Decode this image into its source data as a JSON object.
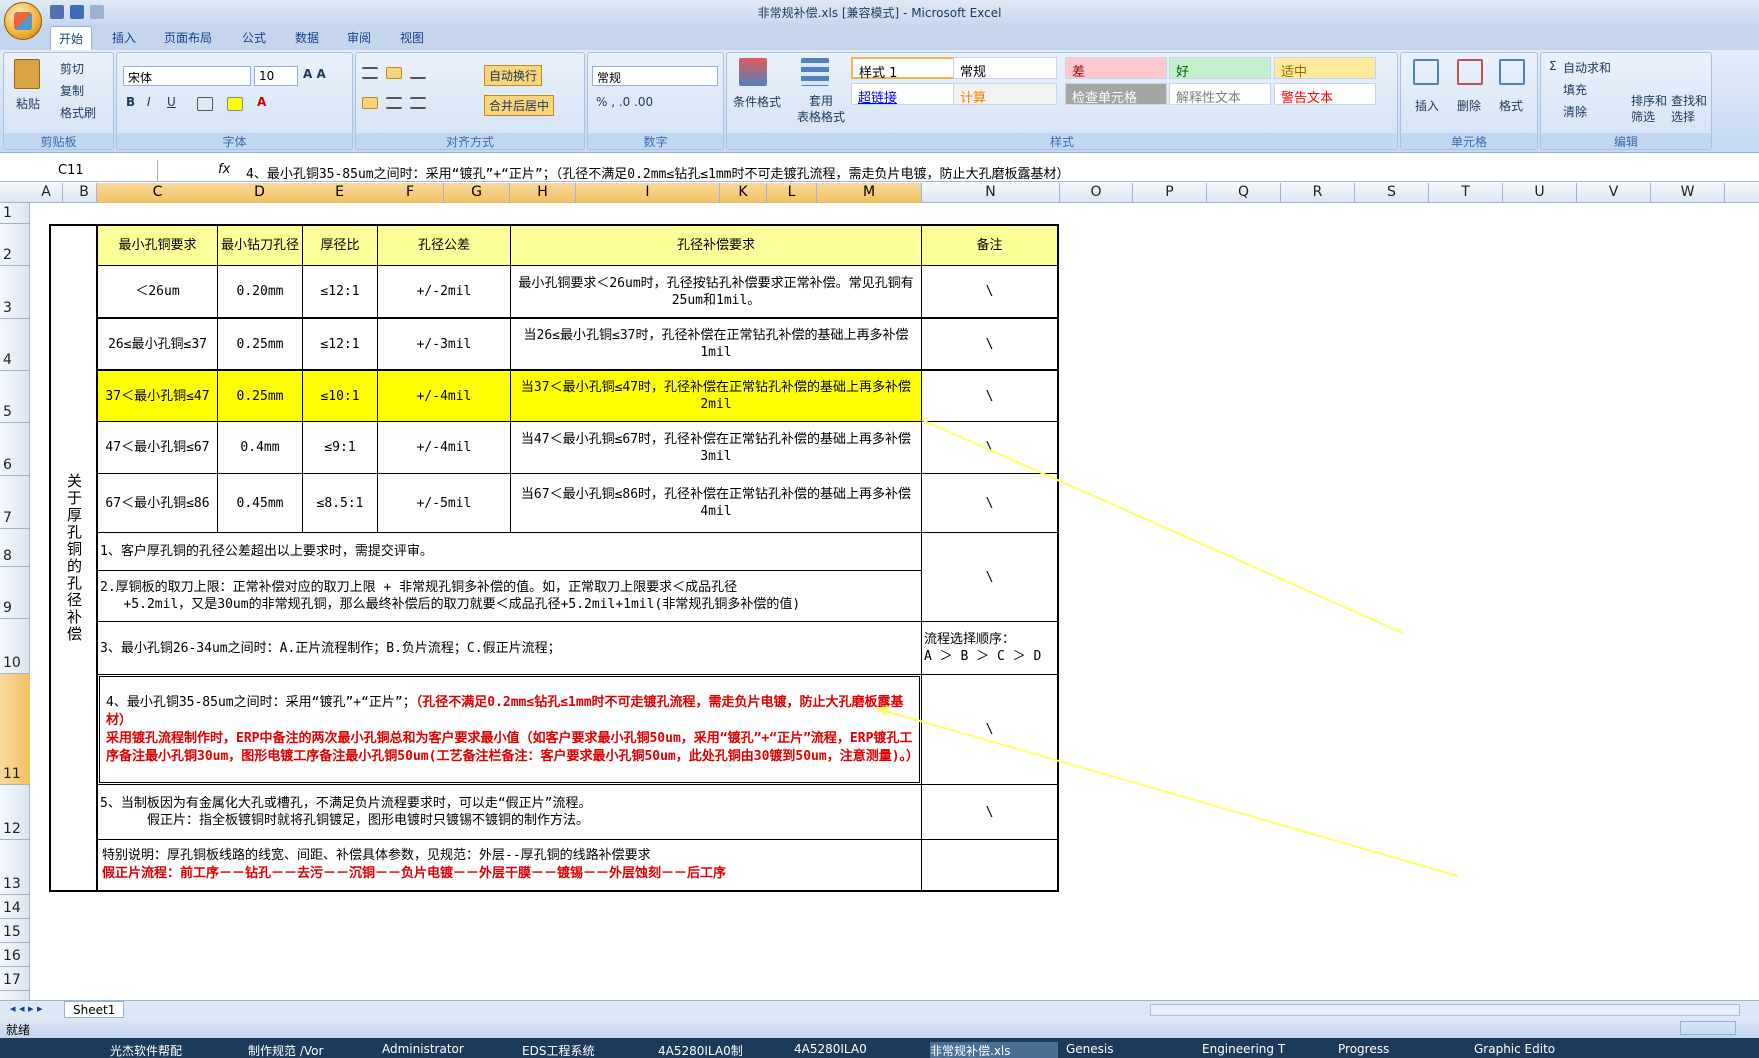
{
  "window": {
    "title": "非常规补偿.xls  [兼容模式] - Microsoft Excel"
  },
  "tabs": [
    "开始",
    "插入",
    "页面布局",
    "公式",
    "数据",
    "审阅",
    "视图"
  ],
  "clipboard": {
    "paste": "粘贴",
    "cut": "剪切",
    "copy": "复制",
    "format_painter": "格式刷",
    "label": "剪贴板"
  },
  "font": {
    "name": "宋体",
    "size": "10",
    "label": "字体"
  },
  "alignment": {
    "wrap": "自动换行",
    "merge": "合并后居中",
    "label": "对齐方式"
  },
  "number": {
    "format": "常规",
    "label": "数字"
  },
  "styles": {
    "cond": "条件格式",
    "table_fmt": "套用\n表格格式",
    "label": "样式",
    "cells": [
      {
        "t": "样式 1",
        "bg": "#ffffff",
        "c": "#000"
      },
      {
        "t": "常规",
        "bg": "#ffffff",
        "c": "#000"
      },
      {
        "t": "差",
        "bg": "#ffc7ce",
        "c": "#9c0006"
      },
      {
        "t": "好",
        "bg": "#c6efce",
        "c": "#006100"
      },
      {
        "t": "适中",
        "bg": "#ffeb9c",
        "c": "#9c6500"
      },
      {
        "t": "超链接",
        "bg": "#ffffff",
        "c": "#0000ff"
      },
      {
        "t": "计算",
        "bg": "#f2f2f2",
        "c": "#fa7d00"
      },
      {
        "t": "检查单元格",
        "bg": "#a5a5a5",
        "c": "#ffffff"
      },
      {
        "t": "解释性文本",
        "bg": "#ffffff",
        "c": "#7f7f7f"
      },
      {
        "t": "警告文本",
        "bg": "#ffffff",
        "c": "#ff0000"
      }
    ]
  },
  "cellsgroup": {
    "insert": "插入",
    "delete": "删除",
    "format": "格式",
    "label": "单元格"
  },
  "editing": {
    "autosum": "自动求和",
    "fill": "填充",
    "clear": "清除",
    "sort": "排序和\n筛选",
    "find": "查找和\n选择",
    "label": "编辑"
  },
  "namebox": "C11",
  "formula": "4、最小孔铜35-85um之间时：采用“镀孔”+“正片”；（孔径不满足0.2mm≤钻孔≤1mm时不可走镀孔流程，需走负片电镀，防止大孔磨板露基材）",
  "columns": [
    "A",
    "B",
    "C",
    "D",
    "E",
    "F",
    "G",
    "H",
    "I",
    "K",
    "L",
    "M",
    "N",
    "O",
    "P",
    "Q",
    "R",
    "S",
    "T",
    "U",
    "V",
    "W"
  ],
  "rows": [
    "1",
    "2",
    "3",
    "4",
    "5",
    "6",
    "7",
    "8",
    "9",
    "10",
    "11",
    "12",
    "13",
    "14",
    "15",
    "16",
    "17"
  ],
  "table": {
    "side_label": "关于厚孔铜的孔径补偿",
    "headers": [
      "最小孔铜要求",
      "最小钻刀孔径",
      "厚径比",
      "孔径公差",
      "孔径补偿要求",
      "备注"
    ],
    "rows": [
      [
        "＜26um",
        "0.20mm",
        "≤12:1",
        "+/-2mil",
        "最小孔铜要求＜26um时，孔径按钻孔补偿要求正常补偿。常见孔铜有25um和1mil。",
        "\\"
      ],
      [
        "26≤最小孔铜≤37",
        "0.25mm",
        "≤12:1",
        "+/-3mil",
        "当26≤最小孔铜≤37时，孔径补偿在正常钻孔补偿的基础上再多补偿1mil",
        "\\"
      ],
      [
        "37＜最小孔铜≤47",
        "0.25mm",
        "≤10:1",
        "+/-4mil",
        "当37＜最小孔铜≤47时，孔径补偿在正常钻孔补偿的基础上再多补偿2mil",
        "\\"
      ],
      [
        "47＜最小孔铜≤67",
        "0.4mm",
        "≤9:1",
        "+/-4mil",
        "当47＜最小孔铜≤67时，孔径补偿在正常钻孔补偿的基础上再多补偿3mil",
        "\\"
      ],
      [
        "67＜最小孔铜≤86",
        "0.45mm",
        "≤8.5:1",
        "+/-5mil",
        "当67＜最小孔铜≤86时，孔径补偿在正常钻孔补偿的基础上再多补偿4mil",
        "\\"
      ]
    ],
    "note1": "1、客户厚孔铜的孔径公差超出以上要求时，需提交评审。",
    "note2": "2.厚铜板的取刀上限：正常补偿对应的取刀上限 + 非常规孔铜多补偿的值。如，正常取刀上限要求＜成品孔径\n   +5.2mil，又是30um的非常规孔铜，那么最终补偿后的取刀就要＜成品孔径+5.2mil+1mil(非常规孔铜多补偿的值)",
    "note89_remark": "\\",
    "note3": "3、最小孔铜26-34um之间时：A.正片流程制作；B.负片流程；C.假正片流程；",
    "note3_remark": "流程选择顺序：\nA ＞ B ＞ C ＞ D",
    "note4_a": "4、最小孔铜35-85um之间时：采用“镀孔”+“正片”；",
    "note4_b": "（孔径不满足0.2mm≤钻孔≤1mm时不可走镀孔流程，需走负片电镀，防止大孔磨板露基材）",
    "note4_c": "采用镀孔流程制作时，ERP中备注的两次最小孔铜总和为客户要求最小值（如客户要求最小孔铜50um，采用“镀孔”+“正片”流程，ERP镀孔工序备注最小孔铜30um，图形电镀工序备注最小孔铜50um(工艺备注栏备注：客户要求最小孔铜50um，此处孔铜由30镀到50um，注意测量)。）",
    "note4_remark": "\\",
    "note5": "5、当制板因为有金属化大孔或槽孔，不满足负片流程要求时，可以走“假正片”流程。\n      假正片：指全板镀铜时就将孔铜镀足，图形电镀时只镀锡不镀铜的制作方法。",
    "note5_remark": "\\",
    "special_a": "特别说明：厚孔铜板线路的线宽、间距、补偿具体参数，见规范：外层--厚孔铜的线路补偿要求",
    "special_b": "假正片流程：前工序－－钻孔－－去污－－沉铜－－负片电镀－－外层干膜－－镀锡－－外层蚀刻－－后工序"
  },
  "sheet_tab": "Sheet1",
  "status": "就绪",
  "taskbar": [
    "光杰软件帮配",
    "制作规范 /Vor",
    "Administrator",
    "EDS工程系统",
    "4A5280ILA0制",
    "4A5280ILA0",
    "非常规补偿.xls",
    "Genesis",
    "Engineering T",
    "Progress",
    "Graphic Edito"
  ]
}
